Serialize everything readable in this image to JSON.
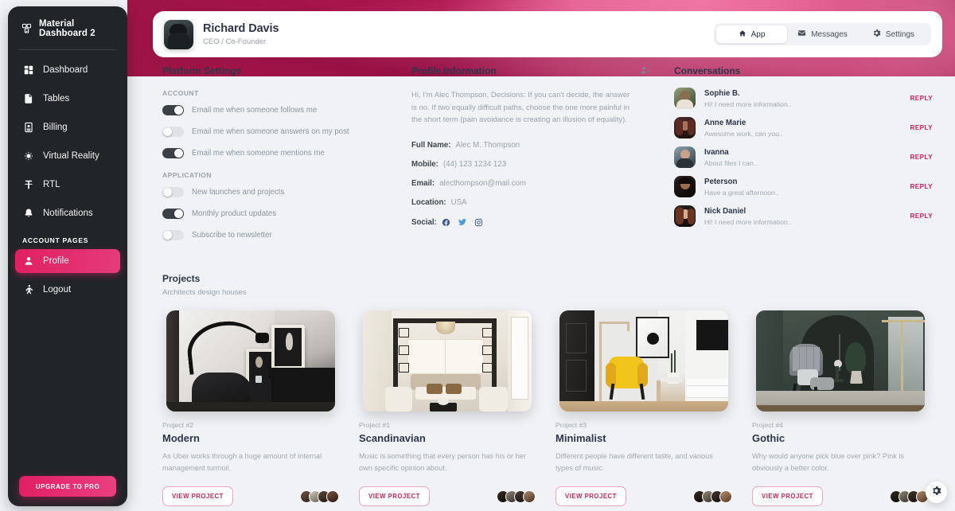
{
  "brand": {
    "title": "Material Dashboard 2",
    "logo_icon": "cube-logo-icon"
  },
  "sidebar": {
    "items": [
      {
        "label": "Dashboard",
        "icon": "dashboard-icon",
        "active": false
      },
      {
        "label": "Tables",
        "icon": "tables-icon",
        "active": false
      },
      {
        "label": "Billing",
        "icon": "billing-icon",
        "active": false
      },
      {
        "label": "Virtual Reality",
        "icon": "vr-icon",
        "active": false
      },
      {
        "label": "RTL",
        "icon": "rtl-icon",
        "active": false
      },
      {
        "label": "Notifications",
        "icon": "bell-icon",
        "active": false
      }
    ],
    "section_label": "ACCOUNT PAGES",
    "account_items": [
      {
        "label": "Profile",
        "icon": "person-icon",
        "active": true
      },
      {
        "label": "Logout",
        "icon": "logout-icon",
        "active": false
      }
    ],
    "upgrade_label": "UPGRADE TO PRO",
    "accent_color": "#e01f62"
  },
  "profile_header": {
    "name": "Richard Davis",
    "role": "CEO / Co-Founder",
    "avatar_icon": "user-avatar",
    "tabs": [
      {
        "label": "App",
        "icon": "home-icon",
        "active": true
      },
      {
        "label": "Messages",
        "icon": "email-icon",
        "active": false
      },
      {
        "label": "Settings",
        "icon": "gear-icon",
        "active": false
      }
    ]
  },
  "platform_settings": {
    "title": "Platform Settings",
    "account_label": "ACCOUNT",
    "account_toggles": [
      {
        "label": "Email me when someone follows me",
        "on": true
      },
      {
        "label": "Email me when someone answers on my post",
        "on": false
      },
      {
        "label": "Email me when someone mentions me",
        "on": true
      }
    ],
    "application_label": "APPLICATION",
    "application_toggles": [
      {
        "label": "New launches and projects",
        "on": false
      },
      {
        "label": "Monthly product updates",
        "on": true
      },
      {
        "label": "Subscribe to newsletter",
        "on": false
      }
    ]
  },
  "profile_information": {
    "title": "Profile Information",
    "edit_icon": "edit-profile-icon",
    "bio": "Hi, I'm Alec Thompson, Decisions: If you can't decide, the answer is no. If two equally difficult paths, choose the one more painful in the short term (pain avoidance is creating an illusion of equality).",
    "fields": [
      {
        "key": "Full Name:",
        "value": "Alec M. Thompson"
      },
      {
        "key": "Mobile:",
        "value": "(44) 123 1234 123"
      },
      {
        "key": "Email:",
        "value": "alecthompson@mail.com"
      },
      {
        "key": "Location:",
        "value": "USA"
      }
    ],
    "social_key": "Social:",
    "social_icons": [
      "facebook-icon",
      "twitter-icon",
      "instagram-icon"
    ]
  },
  "conversations": {
    "title": "Conversations",
    "reply_label": "REPLY",
    "items": [
      {
        "name": "Sophie B.",
        "message": "Hi! I need more information..",
        "avatar": "avatar-sophie"
      },
      {
        "name": "Anne Marie",
        "message": "Awesome work, can you..",
        "avatar": "avatar-anne"
      },
      {
        "name": "Ivanna",
        "message": "About files I can..",
        "avatar": "avatar-ivanna"
      },
      {
        "name": "Peterson",
        "message": "Have a great afternoon..",
        "avatar": "avatar-peterson"
      },
      {
        "name": "Nick Daniel",
        "message": "Hi! I need more information..",
        "avatar": "avatar-nick"
      }
    ]
  },
  "projects": {
    "title": "Projects",
    "subtitle": "Architects design houses",
    "view_label": "VIEW PROJECT",
    "items": [
      {
        "number": "Project #2",
        "name": "Modern",
        "description": "As Uber works through a huge amount of internal management turmoil.",
        "image": "project-image-modern"
      },
      {
        "number": "Project #1",
        "name": "Scandinavian",
        "description": "Music is something that every person has his or her own specific opinion about.",
        "image": "project-image-scandinavian"
      },
      {
        "number": "Project #3",
        "name": "Minimalist",
        "description": "Different people have different taste, and various types of music.",
        "image": "project-image-minimalist"
      },
      {
        "number": "Project #4",
        "name": "Gothic",
        "description": "Why would anyone pick blue over pink? Pink is obviously a better color.",
        "image": "project-image-gothic"
      }
    ]
  },
  "fab": {
    "icon": "gear-icon"
  }
}
